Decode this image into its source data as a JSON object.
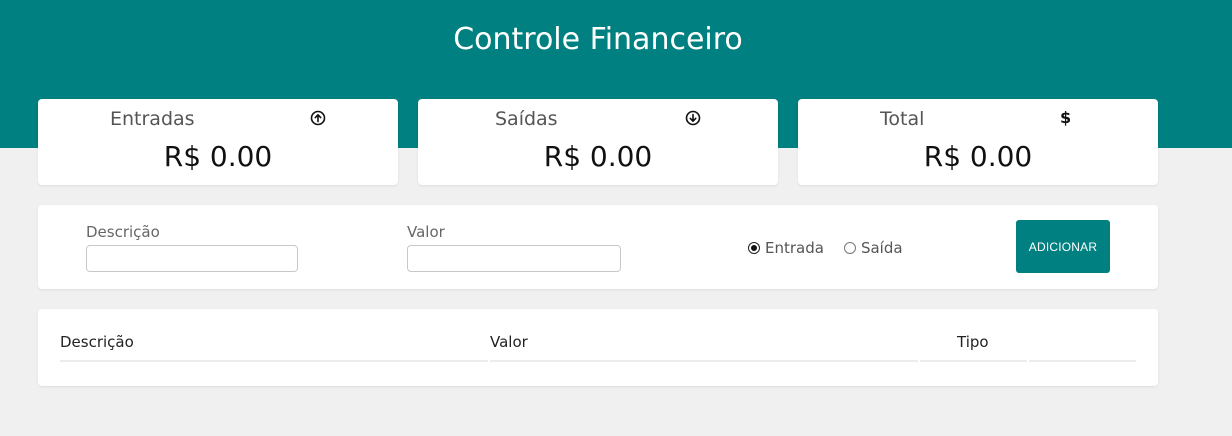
{
  "header": {
    "title": "Controle Financeiro",
    "background_color": "#008080"
  },
  "summary": {
    "income": {
      "label": "Entradas",
      "value": "R$ 0.00",
      "icon": "arrow-up-circle-icon"
    },
    "expense": {
      "label": "Saídas",
      "value": "R$ 0.00",
      "icon": "arrow-down-circle-icon"
    },
    "total": {
      "label": "Total",
      "value": "R$ 0.00",
      "icon": "dollar-icon"
    }
  },
  "form": {
    "description_label": "Descrição",
    "description_value": "",
    "amount_label": "Valor",
    "amount_value": "",
    "type_options": [
      {
        "label": "Entrada",
        "checked": true
      },
      {
        "label": "Saída",
        "checked": false
      }
    ],
    "add_button_label": "ADICIONAR",
    "accent_color": "#008080"
  },
  "table": {
    "columns": [
      "Descrição",
      "Valor",
      "Tipo",
      ""
    ],
    "rows": []
  }
}
